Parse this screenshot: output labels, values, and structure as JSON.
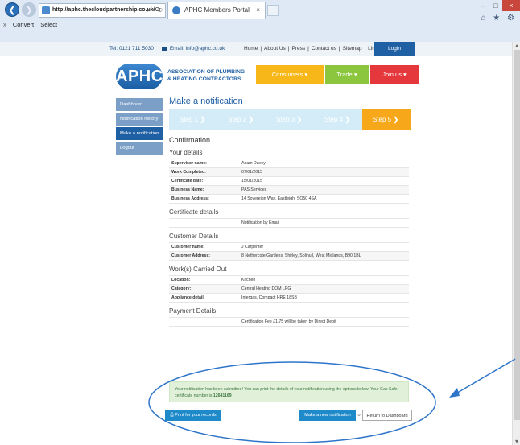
{
  "browser": {
    "url_host": "http://aphc.thecloudpartnership.co.uk/",
    "url_rest": "Cr",
    "address_tools": "⌕ ▾ ↻",
    "tab_title": "APHC Members Portal",
    "tab_close": "×",
    "window_minimize": "–",
    "window_maximize": "□",
    "window_close": "×",
    "toolbar_icons": "⌂ ★ ⚙",
    "favbar_close": "x",
    "favbar_items": [
      "Convert",
      "Select"
    ],
    "scroll_up": "▴",
    "scroll_down": "▾"
  },
  "topbar": {
    "tel": "Tel: 0121 711 5030",
    "email": "Email: info@aphc.co.uk",
    "links": [
      "Home",
      "About Us",
      "Press",
      "Contact us",
      "Sitemap",
      "Links"
    ],
    "login": "Login"
  },
  "logo": {
    "mark": "APHC",
    "line1": "Association of Plumbing",
    "line2": "& Heating Contractors"
  },
  "topnav": {
    "consumers": "Consumers",
    "trade": "Trade",
    "join": "Join us",
    "chevron": "▾"
  },
  "sidebar": {
    "items": [
      {
        "label": "Dashboard"
      },
      {
        "label": "Notification history"
      },
      {
        "label": "Make a notification"
      },
      {
        "label": "Logout"
      }
    ]
  },
  "main": {
    "title": "Make a notification",
    "steps": [
      "Step 1",
      "Step 2",
      "Step 3",
      "Step 4",
      "Step 5"
    ],
    "step_chevron": "❯",
    "confirmation": "Confirmation",
    "your_details": {
      "heading": "Your details",
      "rows": [
        {
          "k": "Supervisor name:",
          "v": "Adam Davey"
        },
        {
          "k": "Work Completed:",
          "v": "07/01/2015"
        },
        {
          "k": "Certificate date:",
          "v": "15/01/2015"
        },
        {
          "k": "Business Name:",
          "v": "PAS Services"
        },
        {
          "k": "Business Address:",
          "v": "14 Sovereign Way, Eastleigh, SO50 4SA"
        }
      ]
    },
    "certificate_details": {
      "heading": "Certificate details",
      "rows": [
        {
          "k": "",
          "v": "Notification by Email"
        }
      ]
    },
    "customer_details": {
      "heading": "Customer Details",
      "rows": [
        {
          "k": "Customer name:",
          "v": "J Carpenter"
        },
        {
          "k": "Customer Address:",
          "v": "8 Nethercote Gardens, Shirley, Solihull, West Midlands, B90 1BL"
        }
      ]
    },
    "works": {
      "heading": "Work(s) Carried Out",
      "rows": [
        {
          "k": "Location:",
          "v": "Kitchen"
        },
        {
          "k": "Category:",
          "v": "Central Heating DOM LPG"
        },
        {
          "k": "Appliance detail:",
          "v": "Intergas, Compact HRE 18SB"
        }
      ]
    },
    "payment": {
      "heading": "Payment Details",
      "rows": [
        {
          "k": "",
          "v": "Certification Fee £1.75 will be taken by Direct Debit"
        }
      ]
    }
  },
  "success": {
    "message": "Your notification has been submitted! You can print the details of your notification using the options below. Your Gas Safe certificate number is ",
    "cert_number": "12641169"
  },
  "actions": {
    "print_icon": "⎙",
    "print": "Print for your records",
    "new": "Make a new notification",
    "or": "or",
    "return": "Return to Dashboard"
  },
  "colors": {
    "brand_blue": "#1f5fa3",
    "consumers": "#f7b718",
    "trade": "#8cc63f",
    "join": "#e4383d",
    "step_active": "#f7a71a",
    "annotation": "#2e75c9"
  }
}
